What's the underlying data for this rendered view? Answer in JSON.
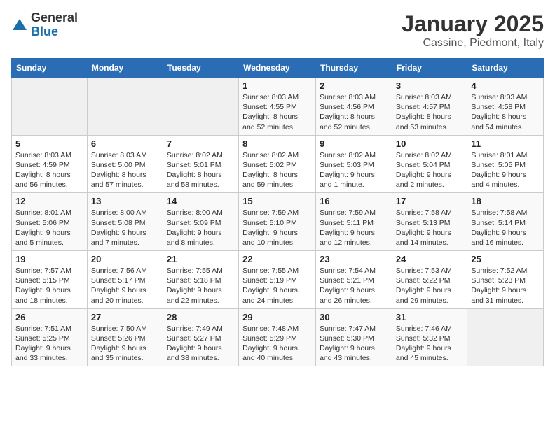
{
  "header": {
    "logo_general": "General",
    "logo_blue": "Blue",
    "month": "January 2025",
    "location": "Cassine, Piedmont, Italy"
  },
  "weekdays": [
    "Sunday",
    "Monday",
    "Tuesday",
    "Wednesday",
    "Thursday",
    "Friday",
    "Saturday"
  ],
  "weeks": [
    [
      {
        "day": "",
        "info": ""
      },
      {
        "day": "",
        "info": ""
      },
      {
        "day": "",
        "info": ""
      },
      {
        "day": "1",
        "info": "Sunrise: 8:03 AM\nSunset: 4:55 PM\nDaylight: 8 hours and 52 minutes."
      },
      {
        "day": "2",
        "info": "Sunrise: 8:03 AM\nSunset: 4:56 PM\nDaylight: 8 hours and 52 minutes."
      },
      {
        "day": "3",
        "info": "Sunrise: 8:03 AM\nSunset: 4:57 PM\nDaylight: 8 hours and 53 minutes."
      },
      {
        "day": "4",
        "info": "Sunrise: 8:03 AM\nSunset: 4:58 PM\nDaylight: 8 hours and 54 minutes."
      }
    ],
    [
      {
        "day": "5",
        "info": "Sunrise: 8:03 AM\nSunset: 4:59 PM\nDaylight: 8 hours and 56 minutes."
      },
      {
        "day": "6",
        "info": "Sunrise: 8:03 AM\nSunset: 5:00 PM\nDaylight: 8 hours and 57 minutes."
      },
      {
        "day": "7",
        "info": "Sunrise: 8:02 AM\nSunset: 5:01 PM\nDaylight: 8 hours and 58 minutes."
      },
      {
        "day": "8",
        "info": "Sunrise: 8:02 AM\nSunset: 5:02 PM\nDaylight: 8 hours and 59 minutes."
      },
      {
        "day": "9",
        "info": "Sunrise: 8:02 AM\nSunset: 5:03 PM\nDaylight: 9 hours and 1 minute."
      },
      {
        "day": "10",
        "info": "Sunrise: 8:02 AM\nSunset: 5:04 PM\nDaylight: 9 hours and 2 minutes."
      },
      {
        "day": "11",
        "info": "Sunrise: 8:01 AM\nSunset: 5:05 PM\nDaylight: 9 hours and 4 minutes."
      }
    ],
    [
      {
        "day": "12",
        "info": "Sunrise: 8:01 AM\nSunset: 5:06 PM\nDaylight: 9 hours and 5 minutes."
      },
      {
        "day": "13",
        "info": "Sunrise: 8:00 AM\nSunset: 5:08 PM\nDaylight: 9 hours and 7 minutes."
      },
      {
        "day": "14",
        "info": "Sunrise: 8:00 AM\nSunset: 5:09 PM\nDaylight: 9 hours and 8 minutes."
      },
      {
        "day": "15",
        "info": "Sunrise: 7:59 AM\nSunset: 5:10 PM\nDaylight: 9 hours and 10 minutes."
      },
      {
        "day": "16",
        "info": "Sunrise: 7:59 AM\nSunset: 5:11 PM\nDaylight: 9 hours and 12 minutes."
      },
      {
        "day": "17",
        "info": "Sunrise: 7:58 AM\nSunset: 5:13 PM\nDaylight: 9 hours and 14 minutes."
      },
      {
        "day": "18",
        "info": "Sunrise: 7:58 AM\nSunset: 5:14 PM\nDaylight: 9 hours and 16 minutes."
      }
    ],
    [
      {
        "day": "19",
        "info": "Sunrise: 7:57 AM\nSunset: 5:15 PM\nDaylight: 9 hours and 18 minutes."
      },
      {
        "day": "20",
        "info": "Sunrise: 7:56 AM\nSunset: 5:17 PM\nDaylight: 9 hours and 20 minutes."
      },
      {
        "day": "21",
        "info": "Sunrise: 7:55 AM\nSunset: 5:18 PM\nDaylight: 9 hours and 22 minutes."
      },
      {
        "day": "22",
        "info": "Sunrise: 7:55 AM\nSunset: 5:19 PM\nDaylight: 9 hours and 24 minutes."
      },
      {
        "day": "23",
        "info": "Sunrise: 7:54 AM\nSunset: 5:21 PM\nDaylight: 9 hours and 26 minutes."
      },
      {
        "day": "24",
        "info": "Sunrise: 7:53 AM\nSunset: 5:22 PM\nDaylight: 9 hours and 29 minutes."
      },
      {
        "day": "25",
        "info": "Sunrise: 7:52 AM\nSunset: 5:23 PM\nDaylight: 9 hours and 31 minutes."
      }
    ],
    [
      {
        "day": "26",
        "info": "Sunrise: 7:51 AM\nSunset: 5:25 PM\nDaylight: 9 hours and 33 minutes."
      },
      {
        "day": "27",
        "info": "Sunrise: 7:50 AM\nSunset: 5:26 PM\nDaylight: 9 hours and 35 minutes."
      },
      {
        "day": "28",
        "info": "Sunrise: 7:49 AM\nSunset: 5:27 PM\nDaylight: 9 hours and 38 minutes."
      },
      {
        "day": "29",
        "info": "Sunrise: 7:48 AM\nSunset: 5:29 PM\nDaylight: 9 hours and 40 minutes."
      },
      {
        "day": "30",
        "info": "Sunrise: 7:47 AM\nSunset: 5:30 PM\nDaylight: 9 hours and 43 minutes."
      },
      {
        "day": "31",
        "info": "Sunrise: 7:46 AM\nSunset: 5:32 PM\nDaylight: 9 hours and 45 minutes."
      },
      {
        "day": "",
        "info": ""
      }
    ]
  ]
}
